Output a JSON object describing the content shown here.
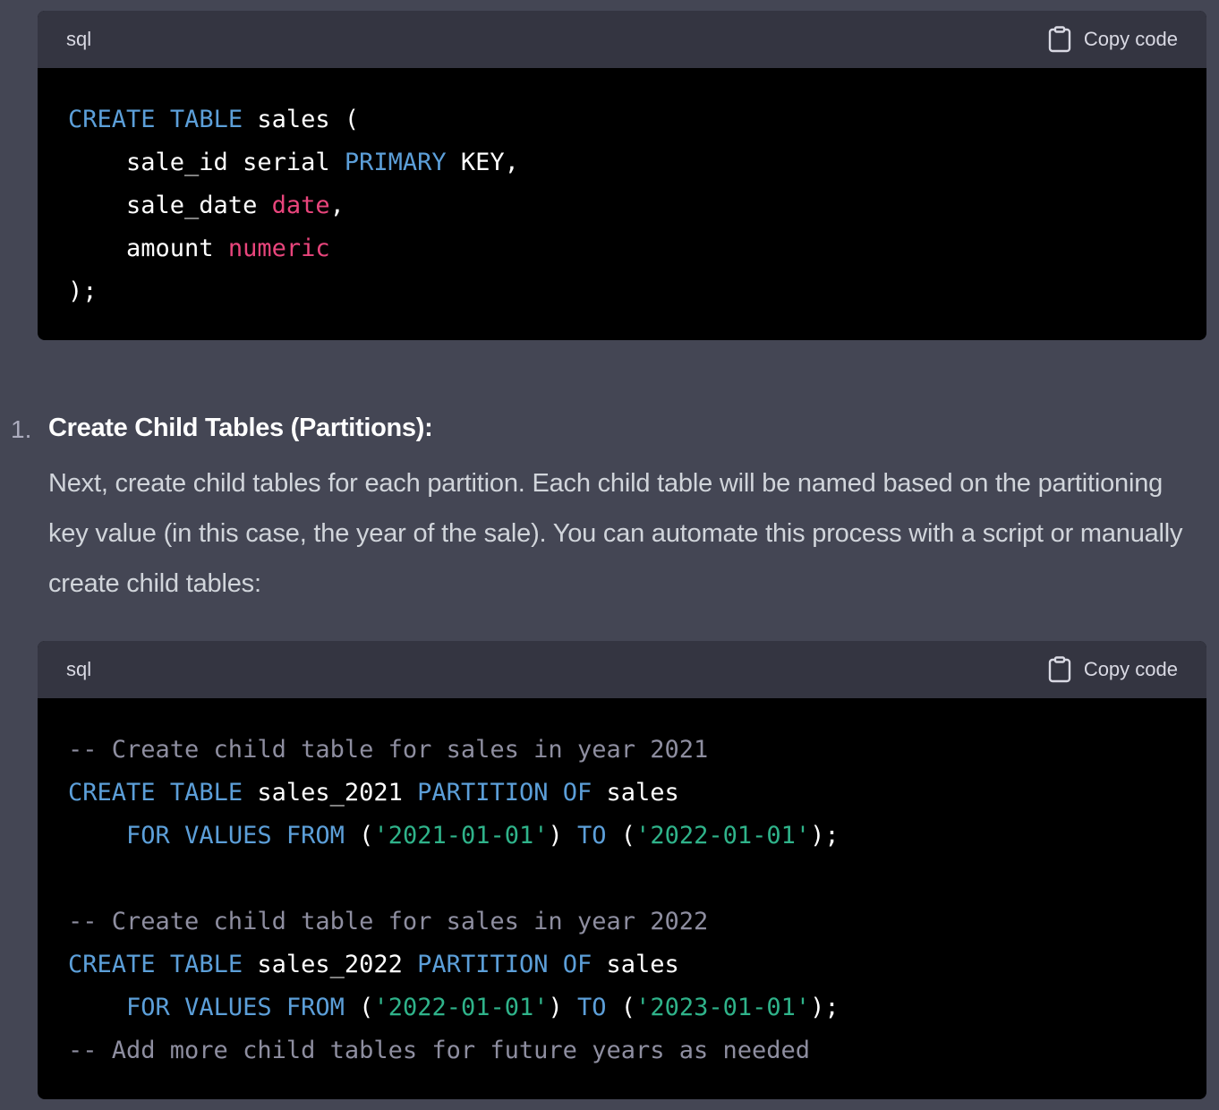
{
  "block1": {
    "language": "sql",
    "copy_label": "Copy code",
    "lines": [
      [
        {
          "t": "k",
          "v": "CREATE"
        },
        {
          "t": "p",
          "v": " "
        },
        {
          "t": "k",
          "v": "TABLE"
        },
        {
          "t": "p",
          "v": " sales ("
        }
      ],
      [
        {
          "t": "p",
          "v": "    sale_id serial "
        },
        {
          "t": "k",
          "v": "PRIMARY"
        },
        {
          "t": "p",
          "v": " KEY,"
        }
      ],
      [
        {
          "t": "p",
          "v": "    sale_date "
        },
        {
          "t": "t",
          "v": "date"
        },
        {
          "t": "p",
          "v": ","
        }
      ],
      [
        {
          "t": "p",
          "v": "    amount "
        },
        {
          "t": "t",
          "v": "numeric"
        }
      ],
      [
        {
          "t": "p",
          "v": ");"
        }
      ]
    ]
  },
  "list": {
    "number": "1.",
    "title": "Create Child Tables (Partitions):",
    "text": "Next, create child tables for each partition. Each child table will be named based on the partitioning key value (in this case, the year of the sale). You can automate this process with a script or manually create child tables:"
  },
  "block2": {
    "language": "sql",
    "copy_label": "Copy code",
    "lines": [
      [
        {
          "t": "c",
          "v": "-- Create child table for sales in year 2021"
        }
      ],
      [
        {
          "t": "k",
          "v": "CREATE"
        },
        {
          "t": "p",
          "v": " "
        },
        {
          "t": "k",
          "v": "TABLE"
        },
        {
          "t": "p",
          "v": " sales_2021 "
        },
        {
          "t": "k",
          "v": "PARTITION"
        },
        {
          "t": "p",
          "v": " "
        },
        {
          "t": "k",
          "v": "OF"
        },
        {
          "t": "p",
          "v": " sales"
        }
      ],
      [
        {
          "t": "p",
          "v": "    "
        },
        {
          "t": "k",
          "v": "FOR"
        },
        {
          "t": "p",
          "v": " "
        },
        {
          "t": "k",
          "v": "VALUES"
        },
        {
          "t": "p",
          "v": " "
        },
        {
          "t": "k",
          "v": "FROM"
        },
        {
          "t": "p",
          "v": " ("
        },
        {
          "t": "s",
          "v": "'2021-01-01'"
        },
        {
          "t": "p",
          "v": ") "
        },
        {
          "t": "k",
          "v": "TO"
        },
        {
          "t": "p",
          "v": " ("
        },
        {
          "t": "s",
          "v": "'2022-01-01'"
        },
        {
          "t": "p",
          "v": ");"
        }
      ],
      [],
      [
        {
          "t": "c",
          "v": "-- Create child table for sales in year 2022"
        }
      ],
      [
        {
          "t": "k",
          "v": "CREATE"
        },
        {
          "t": "p",
          "v": " "
        },
        {
          "t": "k",
          "v": "TABLE"
        },
        {
          "t": "p",
          "v": " sales_2022 "
        },
        {
          "t": "k",
          "v": "PARTITION"
        },
        {
          "t": "p",
          "v": " "
        },
        {
          "t": "k",
          "v": "OF"
        },
        {
          "t": "p",
          "v": " sales"
        }
      ],
      [
        {
          "t": "p",
          "v": "    "
        },
        {
          "t": "k",
          "v": "FOR"
        },
        {
          "t": "p",
          "v": " "
        },
        {
          "t": "k",
          "v": "VALUES"
        },
        {
          "t": "p",
          "v": " "
        },
        {
          "t": "k",
          "v": "FROM"
        },
        {
          "t": "p",
          "v": " ("
        },
        {
          "t": "s",
          "v": "'2022-01-01'"
        },
        {
          "t": "p",
          "v": ") "
        },
        {
          "t": "k",
          "v": "TO"
        },
        {
          "t": "p",
          "v": " ("
        },
        {
          "t": "s",
          "v": "'2023-01-01'"
        },
        {
          "t": "p",
          "v": ");"
        }
      ],
      [
        {
          "t": "c",
          "v": "-- Add more child tables for future years as needed"
        }
      ]
    ]
  },
  "colors": {
    "background": "#444654",
    "code_header": "#343541",
    "code_body": "#000000",
    "keyword": "#5c9fd9",
    "type": "#e9457c",
    "string": "#2fb38a",
    "comment": "#8e8ea0"
  },
  "icons": {
    "copy": "clipboard-icon"
  }
}
